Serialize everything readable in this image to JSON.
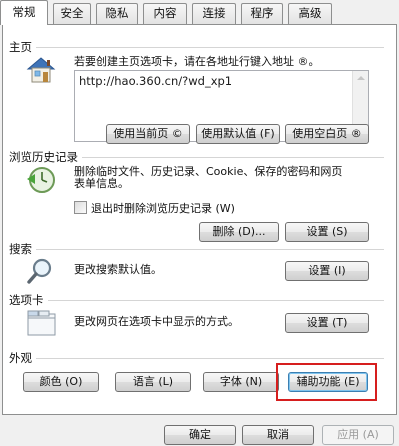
{
  "tabs": [
    "常规",
    "安全",
    "隐私",
    "内容",
    "连接",
    "程序",
    "高级"
  ],
  "homepage": {
    "title": "主页",
    "description": "若要创建主页选项卡，请在各地址行键入地址 ®。",
    "url_value": "http://hao.360.cn/?wd_xp1",
    "btn_current": "使用当前页 ©",
    "btn_default": "使用默认值 (F)",
    "btn_blank": "使用空白页 ®"
  },
  "history": {
    "title": "浏览历史记录",
    "description_line1": "删除临时文件、历史记录、Cookie、保存的密码和网页",
    "description_line2": "表单信息。",
    "checkbox_label": "退出时删除浏览历史记录 (W)",
    "btn_delete": "删除 (D)...",
    "btn_settings": "设置 (S)"
  },
  "search": {
    "title": "搜索",
    "description": "更改搜索默认值。",
    "btn_settings": "设置 (I)"
  },
  "tabs_section": {
    "title": "选项卡",
    "description": "更改网页在选项卡中显示的方式。",
    "btn_settings": "设置 (T)"
  },
  "appearance": {
    "title": "外观",
    "btn_colors": "颜色 (O)",
    "btn_languages": "语言 (L)",
    "btn_fonts": "字体 (N)",
    "btn_accessibility": "辅助功能 (E)"
  },
  "footer": {
    "btn_ok": "确定",
    "btn_cancel": "取消",
    "btn_apply": "应用 (A)"
  },
  "colors": {
    "highlight": "#d61e1e"
  }
}
